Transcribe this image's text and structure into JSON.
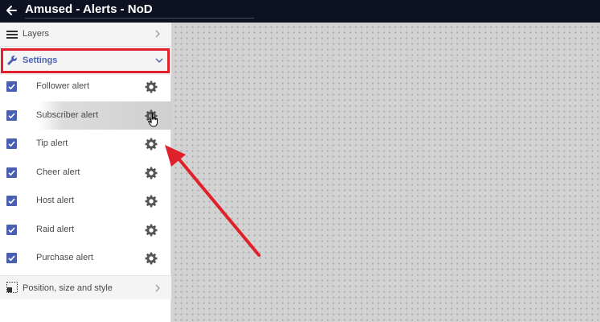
{
  "app": {
    "title": "Amused - Alerts - NoD"
  },
  "sidebar": {
    "layers_label": "Layers",
    "settings_label": "Settings",
    "position_label": "Position, size and style",
    "alerts": [
      {
        "label": "Follower alert",
        "checked": true
      },
      {
        "label": "Subscriber alert",
        "checked": true
      },
      {
        "label": "Tip alert",
        "checked": true
      },
      {
        "label": "Cheer alert",
        "checked": true
      },
      {
        "label": "Host alert",
        "checked": true
      },
      {
        "label": "Raid alert",
        "checked": true
      },
      {
        "label": "Purchase alert",
        "checked": true
      }
    ]
  },
  "colors": {
    "topbar": "#0d1122",
    "accent": "#4b5fb0",
    "highlight_outline": "#e0212b",
    "annotation_arrow": "#e0212b"
  },
  "icons": {
    "back": "back-arrow-icon",
    "layers": "layers-icon",
    "settings": "wrench-icon",
    "alert_settings": "gear-icon",
    "position": "frame-icon",
    "chevron_right": "chevron-right-icon",
    "chevron_down": "chevron-down-icon"
  }
}
